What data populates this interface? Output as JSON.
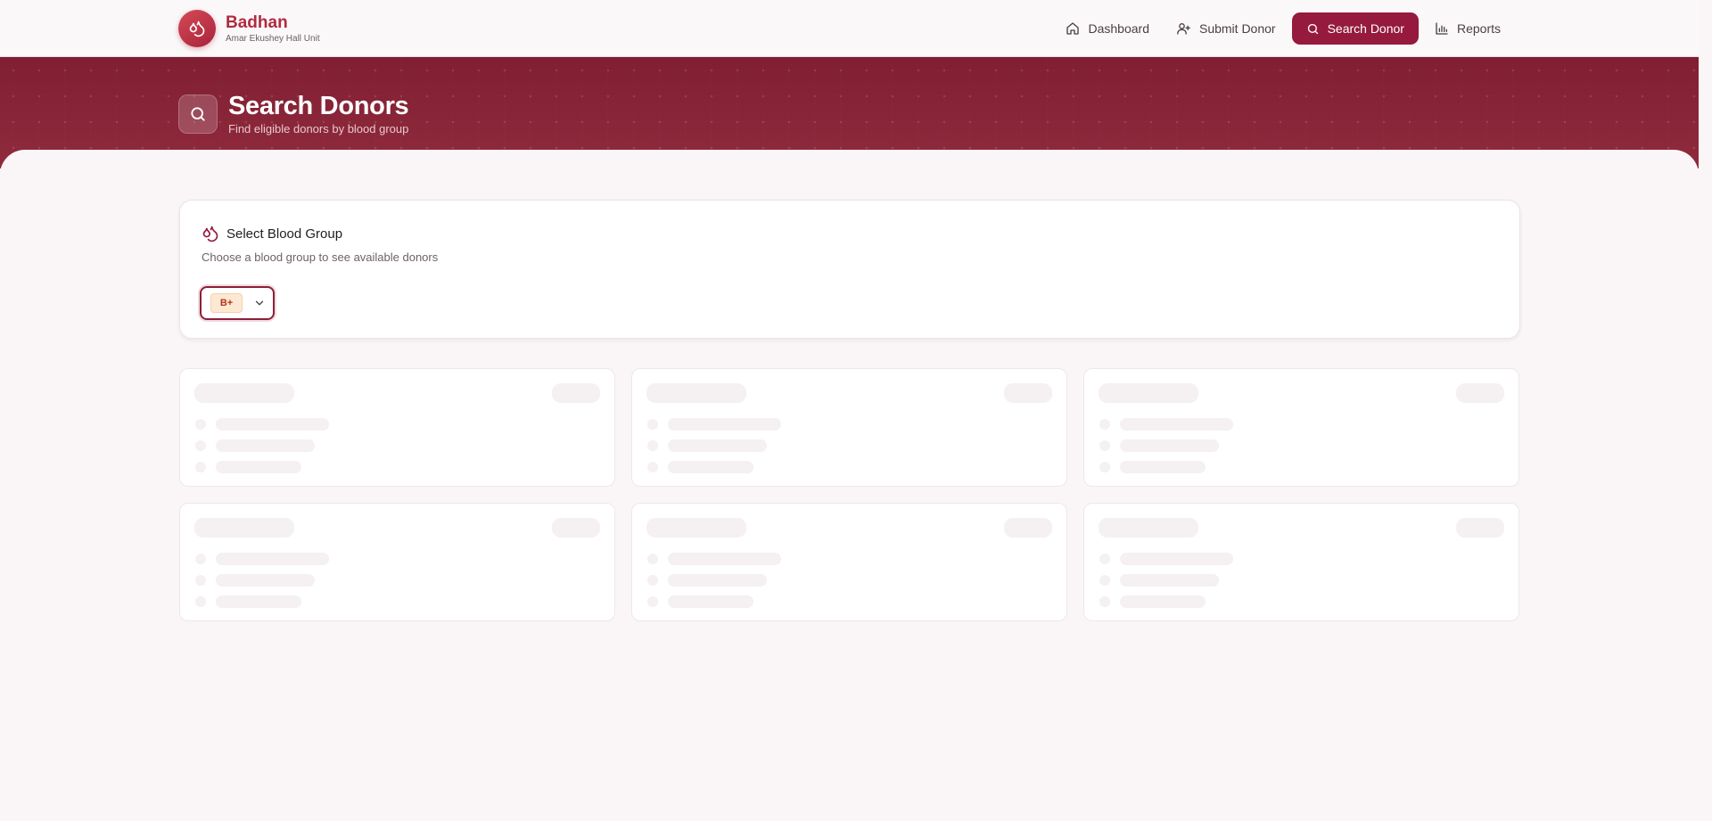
{
  "app": {
    "name": "Badhan",
    "subtitle": "Amar Ekushey Hall Unit",
    "logo_icon": "blood-drop-icon"
  },
  "nav": {
    "items": [
      {
        "label": "Dashboard",
        "icon": "home-icon",
        "active": false
      },
      {
        "label": "Submit Donor",
        "icon": "user-plus-icon",
        "active": false
      },
      {
        "label": "Search Donor",
        "icon": "search-icon",
        "active": true
      },
      {
        "label": "Reports",
        "icon": "bar-chart-icon",
        "active": false
      }
    ]
  },
  "hero": {
    "title": "Search Donors",
    "subtitle": "Find eligible donors by blood group",
    "icon": "search-icon"
  },
  "blood_group_card": {
    "title": "Select Blood Group",
    "description": "Choose a blood group to see available donors",
    "selected": "B+",
    "icon": "blood-drops-icon"
  },
  "colors": {
    "brand": "#b02a3f",
    "accent": "#951a3d",
    "hero_bg": "#8a2236",
    "badge_bg": "#fde9d3",
    "badge_text": "#b8331c"
  },
  "loading": {
    "state": "skeleton",
    "placeholder_cards": 6
  }
}
